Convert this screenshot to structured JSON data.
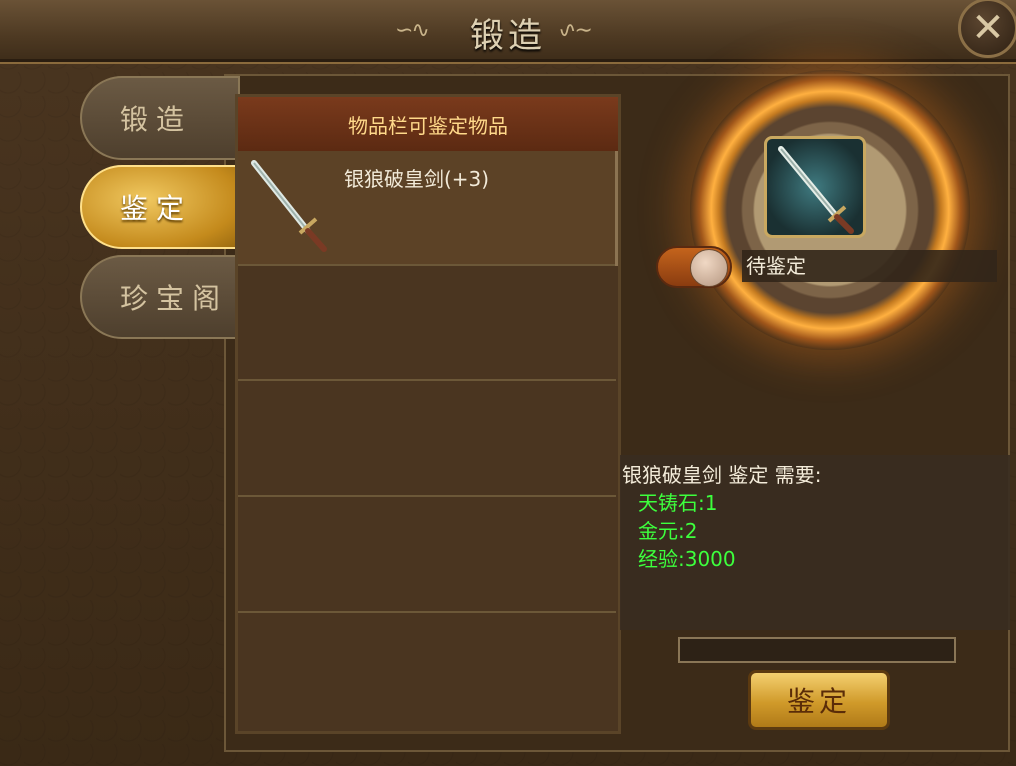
{
  "window": {
    "title": "锻造",
    "close_symbol": "✕"
  },
  "tabs": [
    {
      "label": "锻造",
      "active": false
    },
    {
      "label": "鉴定",
      "active": true
    },
    {
      "label": "珍宝阁",
      "active": false
    }
  ],
  "item_list": {
    "header": "物品栏可鉴定物品",
    "items": [
      {
        "name": "银狼破皇剑(+3)",
        "icon": "sword-icon"
      }
    ],
    "empty_slots": 4
  },
  "identify": {
    "slot_icon": "sword-icon",
    "status": "待鉴定",
    "requirement_title": "银狼破皇剑 鉴定 需要:",
    "requirements": [
      "天铸石:1",
      "金元:2",
      "经验:3000"
    ],
    "button_label": "鉴定"
  },
  "colors": {
    "requirement_text": "#3dff3d",
    "header_text": "#ffd98a",
    "active_tab": "#f0c860"
  }
}
